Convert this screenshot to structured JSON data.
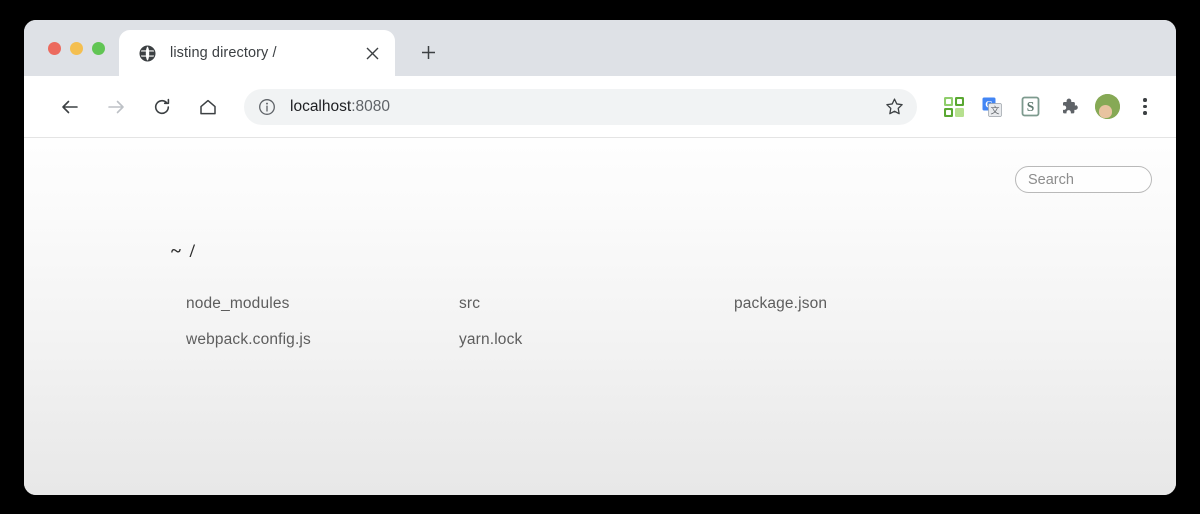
{
  "window": {
    "traffic_lights": [
      {
        "name": "close",
        "color": "#ec6a5e"
      },
      {
        "name": "minimize",
        "color": "#f4bf50"
      },
      {
        "name": "maximize",
        "color": "#61c554"
      }
    ]
  },
  "tab_strip": {
    "tab": {
      "title": "listing directory /",
      "favicon": "globe-icon",
      "close_label": "×"
    },
    "new_tab_label": "+"
  },
  "toolbar": {
    "back_icon": "arrow-left-icon",
    "forward_icon": "arrow-right-icon",
    "reload_icon": "reload-icon",
    "home_icon": "home-icon",
    "site_info_icon": "info-circle-icon",
    "url": {
      "host": "localhost",
      "port": ":8080",
      "full": "localhost:8080"
    },
    "bookmark_icon": "star-outline-icon",
    "extensions": [
      {
        "name": "qr-grid-extension-icon",
        "color": "#6aa84f"
      },
      {
        "name": "google-translate-extension-icon",
        "color": "#4285f4"
      },
      {
        "name": "stylus-extension-icon",
        "color": "#7d9a8e"
      },
      {
        "name": "puzzle-extensions-icon",
        "color": "#5f6368"
      }
    ],
    "avatar_name": "profile-avatar",
    "menu_icon": "three-dot-menu-icon"
  },
  "page": {
    "search": {
      "placeholder": "Search",
      "value": ""
    },
    "directory_header": "~ /",
    "entries": [
      "node_modules",
      "src",
      "package.json",
      "webpack.config.js",
      "yarn.lock"
    ]
  }
}
